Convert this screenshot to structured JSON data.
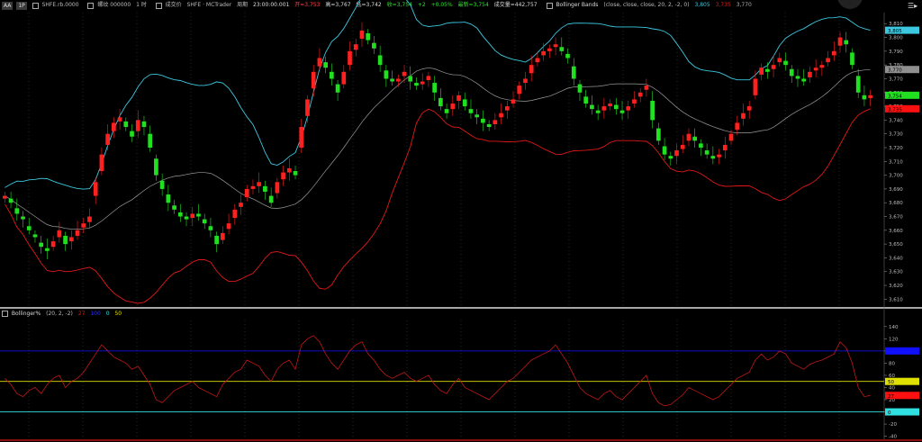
{
  "toolbar": {
    "btn1": "AA",
    "btn2": "1P",
    "symbol": "SHFE.rb.0000",
    "name": "螺纹 000000",
    "interval": "1 时",
    "label_vol": "成交价",
    "source": "SHFE · MCTrader",
    "period_label": "周期",
    "time": "23:00:00.001",
    "open": "开=3,753",
    "high": "高=3,767",
    "low": "低=3,742",
    "close": "收=3,754",
    "change": "+2",
    "pct": "+0.05%",
    "latest": "最新=3,754",
    "volume": "成交量=442,757",
    "indicator": "Bollinger Bands",
    "indicator_params": "(close, close, close, 20, 2, -2, 0)",
    "ind_v1": "3,805",
    "ind_v2": "3,735",
    "ind_v3": "3,770"
  },
  "subpanel": {
    "name": "Bollinger%",
    "params": "(20, 2, -2)",
    "v1": "27",
    "v2": "100",
    "v3": "0",
    "v4": "50"
  },
  "colors": {
    "background": "#000000",
    "up_candle": "#ff2020",
    "down_candle": "#20e020",
    "upper_band": "#3cc8e0",
    "lower_band": "#e01818",
    "middle_band": "#9a9a9a",
    "osc_line": "#c01818",
    "ref_blue": "#1010ff",
    "ref_yellow": "#e0e000",
    "ref_cyan": "#30e0e0",
    "grid": "#404040"
  },
  "chart_data": [
    {
      "type": "candlestick",
      "title": "",
      "ylim": [
        3605,
        3818
      ],
      "yticks": [
        "3,610",
        "3,620",
        "3,630",
        "3,640",
        "3,650",
        "3,660",
        "3,670",
        "3,680",
        "3,690",
        "3,700",
        "3,710",
        "3,720",
        "3,730",
        "3,740",
        "3,750",
        "3,760",
        "3,770",
        "3,780",
        "3,790",
        "3,800",
        "3,810"
      ],
      "close": [
        3685,
        3680,
        3672,
        3668,
        3660,
        3655,
        3648,
        3645,
        3652,
        3660,
        3650,
        3655,
        3660,
        3665,
        3670,
        3695,
        3715,
        3730,
        3738,
        3742,
        3735,
        3728,
        3740,
        3735,
        3720,
        3700,
        3690,
        3680,
        3675,
        3670,
        3668,
        3672,
        3670,
        3665,
        3660,
        3650,
        3658,
        3665,
        3675,
        3680,
        3690,
        3692,
        3695,
        3688,
        3680,
        3695,
        3702,
        3705,
        3700,
        3735,
        3755,
        3775,
        3785,
        3778,
        3770,
        3760,
        3775,
        3790,
        3795,
        3805,
        3798,
        3792,
        3780,
        3770,
        3768,
        3770,
        3775,
        3768,
        3765,
        3768,
        3772,
        3760,
        3750,
        3745,
        3752,
        3758,
        3750,
        3745,
        3742,
        3738,
        3735,
        3740,
        3745,
        3750,
        3755,
        3765,
        3770,
        3780,
        3785,
        3790,
        3792,
        3795,
        3790,
        3785,
        3770,
        3760,
        3752,
        3748,
        3745,
        3750,
        3752,
        3748,
        3745,
        3750,
        3755,
        3760,
        3765,
        3740,
        3725,
        3715,
        3712,
        3718,
        3722,
        3730,
        3725,
        3720,
        3715,
        3712,
        3715,
        3722,
        3730,
        3738,
        3745,
        3750,
        3770,
        3778,
        3775,
        3780,
        3785,
        3780,
        3772,
        3770,
        3768,
        3775,
        3778,
        3780,
        3785,
        3790,
        3800,
        3795,
        3780,
        3760,
        3755,
        3758
      ],
      "open_offsets": [
        2,
        -3,
        -4,
        -2,
        -3,
        -2,
        -3,
        -2,
        4,
        5,
        -6,
        3,
        4,
        3,
        4,
        10,
        12,
        8,
        6,
        3,
        -4,
        -4,
        8,
        -4,
        -10,
        -12,
        -6,
        -6,
        -3,
        -3,
        -2,
        3,
        -2,
        -3,
        -3,
        -6,
        5,
        4,
        6,
        3,
        6,
        2,
        3,
        -4,
        -5,
        8,
        5,
        3,
        -3,
        15,
        12,
        12,
        6,
        -4,
        -5,
        -6,
        9,
        10,
        4,
        6,
        -5,
        -4,
        -7,
        -6,
        -2,
        2,
        3,
        -4,
        -2,
        2,
        3,
        -7,
        -6,
        -3,
        4,
        4,
        -5,
        -3,
        -2,
        -3,
        -2,
        3,
        3,
        3,
        3,
        6,
        3,
        6,
        3,
        3,
        2,
        2,
        -3,
        -3,
        -9,
        -6,
        -5,
        -3,
        -2,
        3,
        2,
        -3,
        -2,
        3,
        3,
        3,
        3,
        -14,
        -9,
        -6,
        -2,
        4,
        3,
        5,
        -3,
        -3,
        -3,
        -2,
        2,
        4,
        5,
        5,
        4,
        3,
        12,
        5,
        -2,
        3,
        3,
        -3,
        -5,
        -2,
        -2,
        4,
        2,
        2,
        3,
        3,
        6,
        -3,
        -9,
        -12,
        -3,
        2
      ]
    },
    {
      "type": "line",
      "title": "",
      "ylim": [
        -45,
        150
      ],
      "yticks": [
        "-40",
        "-20",
        "0",
        "20",
        "40",
        "60",
        "80",
        "100",
        "120",
        "140"
      ],
      "reference_lines": [
        100,
        50,
        0
      ],
      "values": [
        55,
        45,
        30,
        25,
        35,
        40,
        30,
        45,
        55,
        60,
        40,
        50,
        55,
        65,
        80,
        95,
        110,
        100,
        90,
        85,
        80,
        70,
        75,
        60,
        45,
        20,
        15,
        25,
        35,
        40,
        45,
        50,
        40,
        35,
        30,
        25,
        45,
        55,
        65,
        70,
        85,
        80,
        75,
        60,
        50,
        70,
        80,
        85,
        70,
        110,
        120,
        125,
        115,
        95,
        80,
        70,
        85,
        100,
        110,
        115,
        95,
        85,
        70,
        60,
        55,
        60,
        65,
        55,
        50,
        55,
        60,
        45,
        35,
        30,
        45,
        55,
        40,
        35,
        30,
        25,
        20,
        30,
        40,
        50,
        55,
        65,
        75,
        85,
        90,
        95,
        100,
        110,
        95,
        80,
        60,
        40,
        30,
        25,
        20,
        30,
        35,
        25,
        20,
        30,
        40,
        50,
        60,
        30,
        15,
        10,
        12,
        20,
        28,
        40,
        35,
        30,
        25,
        20,
        25,
        35,
        45,
        55,
        60,
        65,
        85,
        95,
        85,
        90,
        100,
        95,
        80,
        75,
        70,
        78,
        82,
        85,
        90,
        95,
        115,
        105,
        80,
        40,
        25,
        27
      ]
    }
  ]
}
